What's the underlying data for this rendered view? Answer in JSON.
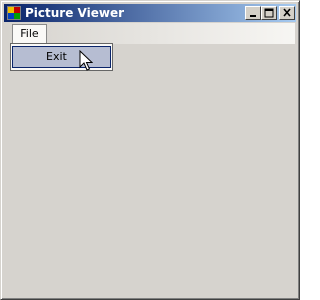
{
  "window": {
    "title": "Picture Viewer",
    "icon": "picture-viewer-app-icon",
    "controls": [
      "minimize-icon",
      "maximize-icon",
      "close-icon"
    ]
  },
  "menubar": {
    "items": [
      {
        "label": "File",
        "open": true
      }
    ]
  },
  "file_menu": {
    "items": [
      {
        "label": "Exit",
        "highlighted": true
      }
    ]
  },
  "cursor": {
    "icon": "arrow-pointer-icon"
  },
  "colors": {
    "title_bar_start": "#0a246a",
    "title_bar_end": "#a6caf0",
    "face": "#d6d3ce",
    "menu_highlight": "#b6bdd2",
    "menu_highlight_border": "#0a246a"
  }
}
